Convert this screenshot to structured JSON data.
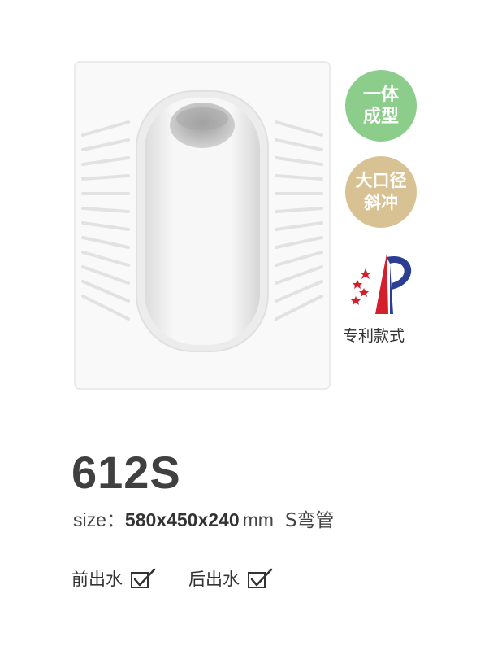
{
  "badges": [
    {
      "line1": "一体",
      "line2": "成型"
    },
    {
      "line1": "大口径",
      "line2": "斜冲"
    }
  ],
  "patent": {
    "label": "专利款式"
  },
  "product": {
    "model": "612S",
    "size_label": "size：",
    "size_value": "580x450x240",
    "size_unit": "mm",
    "trap": "S弯管"
  },
  "outlets": [
    {
      "label": "前出水",
      "checked": true
    },
    {
      "label": "后出水",
      "checked": true
    }
  ],
  "colors": {
    "badge_green": "#8ccd8b",
    "badge_tan": "#d8c293",
    "patent_red": "#d2202c",
    "patent_blue": "#2a3e93"
  }
}
